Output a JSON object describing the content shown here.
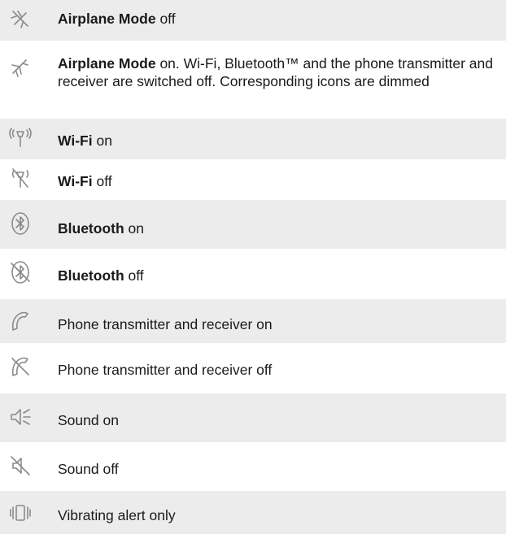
{
  "rows": [
    {
      "bold": "Airplane Mode",
      "rest": " off",
      "icon": "airplane-off-icon"
    },
    {
      "bold": "Airplane Mode",
      "rest": " on. Wi-Fi, Bluetooth™ and the phone transmitter and receiver are switched off. Corresponding icons are dimmed",
      "icon": "airplane-on-icon"
    },
    {
      "bold": "Wi-Fi",
      "rest": " on",
      "icon": "wifi-on-icon"
    },
    {
      "bold": "Wi-Fi",
      "rest": " off",
      "icon": "wifi-off-icon"
    },
    {
      "bold": "Bluetooth",
      "rest": " on",
      "icon": "bluetooth-on-icon"
    },
    {
      "bold": "Bluetooth",
      "rest": " off",
      "icon": "bluetooth-off-icon"
    },
    {
      "bold": "",
      "rest": "Phone transmitter and receiver on",
      "icon": "phone-on-icon"
    },
    {
      "bold": "",
      "rest": "Phone transmitter and receiver off",
      "icon": "phone-off-icon"
    },
    {
      "bold": "",
      "rest": "Sound on",
      "icon": "sound-on-icon"
    },
    {
      "bold": "",
      "rest": "Sound off",
      "icon": "sound-off-icon"
    },
    {
      "bold": "",
      "rest": "Vibrating alert only",
      "icon": "vibrate-icon"
    }
  ]
}
